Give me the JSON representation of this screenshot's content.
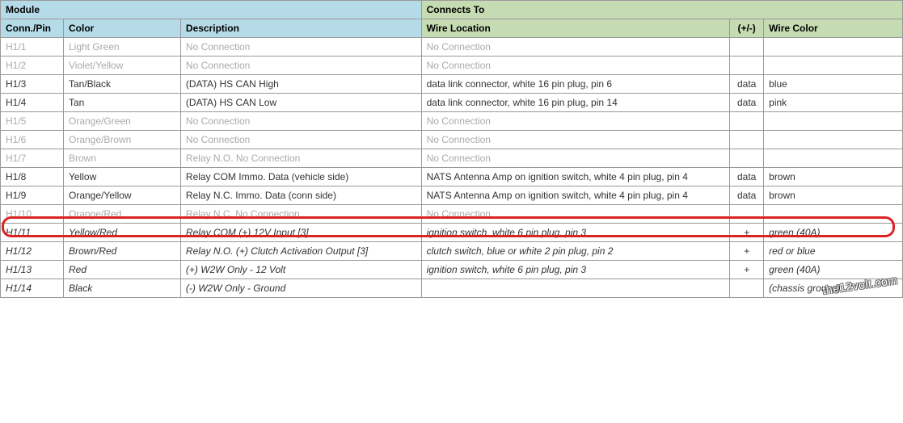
{
  "headers": {
    "module": "Module",
    "connects": "Connects To",
    "pin": "Conn./Pin",
    "color": "Color",
    "desc": "Description",
    "loc": "Wire Location",
    "plus": "(+/-)",
    "wcolor": "Wire Color"
  },
  "rows": [
    {
      "pin": "H1/1",
      "color": "Light Green",
      "desc": "No Connection",
      "loc": "No Connection",
      "plus": "",
      "wcolor": "",
      "style": "inactive",
      "italic": false
    },
    {
      "pin": "H1/2",
      "color": "Violet/Yellow",
      "desc": "No Connection",
      "loc": "No Connection",
      "plus": "",
      "wcolor": "",
      "style": "inactive",
      "italic": false
    },
    {
      "pin": "H1/3",
      "color": "Tan/Black",
      "desc": "(DATA) HS CAN High",
      "loc": "data link connector, white 16 pin plug, pin 6",
      "plus": "data",
      "wcolor": "blue",
      "style": "active",
      "italic": false
    },
    {
      "pin": "H1/4",
      "color": "Tan",
      "desc": "(DATA) HS CAN Low",
      "loc": "data link connector, white 16 pin plug, pin 14",
      "plus": "data",
      "wcolor": "pink",
      "style": "active",
      "italic": false
    },
    {
      "pin": "H1/5",
      "color": "Orange/Green",
      "desc": "No Connection",
      "loc": "No Connection",
      "plus": "",
      "wcolor": "",
      "style": "inactive",
      "italic": false
    },
    {
      "pin": "H1/6",
      "color": "Orange/Brown",
      "desc": "No Connection",
      "loc": "No Connection",
      "plus": "",
      "wcolor": "",
      "style": "inactive",
      "italic": false
    },
    {
      "pin": "H1/7",
      "color": "Brown",
      "desc": "Relay N.O. No Connection",
      "loc": "No Connection",
      "plus": "",
      "wcolor": "",
      "style": "inactive",
      "italic": false
    },
    {
      "pin": "H1/8",
      "color": "Yellow",
      "desc": "Relay COM Immo. Data (vehicle side)",
      "loc": "NATS Antenna Amp on ignition switch, white 4 pin plug, pin 4",
      "plus": "data",
      "wcolor": "brown",
      "style": "active",
      "italic": false
    },
    {
      "pin": "H1/9",
      "color": "Orange/Yellow",
      "desc": "Relay N.C. Immo. Data (conn side)",
      "loc": "NATS Antenna Amp on ignition switch, white 4 pin plug, pin 4",
      "plus": "data",
      "wcolor": "brown",
      "style": "active",
      "italic": false
    },
    {
      "pin": "H1/10",
      "color": "Orange/Red",
      "desc": "Relay N.C. No Connection",
      "loc": "No Connection",
      "plus": "",
      "wcolor": "",
      "style": "inactive",
      "italic": false
    },
    {
      "pin": "H1/11",
      "color": "Yellow/Red",
      "desc": "Relay COM (+) 12V Input [3]",
      "loc": "ignition switch, white 6 pin plug, pin 3",
      "plus": "+",
      "wcolor": "green (40A)",
      "style": "active",
      "italic": true
    },
    {
      "pin": "H1/12",
      "color": "Brown/Red",
      "desc": "Relay N.O. (+) Clutch Activation Output [3]",
      "loc": "clutch switch, blue or white 2 pin plug, pin 2",
      "plus": "+",
      "wcolor": "red or blue",
      "style": "active",
      "italic": true
    },
    {
      "pin": "H1/13",
      "color": "Red",
      "desc": "(+) W2W Only - 12 Volt",
      "loc": "ignition switch, white 6 pin plug, pin 3",
      "plus": "+",
      "wcolor": "green (40A)",
      "style": "active",
      "italic": true
    },
    {
      "pin": "H1/14",
      "color": "Black",
      "desc": "(-) W2W Only - Ground",
      "loc": "",
      "plus": "",
      "wcolor": "(chassis ground)",
      "style": "active",
      "italic": true
    }
  ],
  "watermark": "the12volt.com"
}
